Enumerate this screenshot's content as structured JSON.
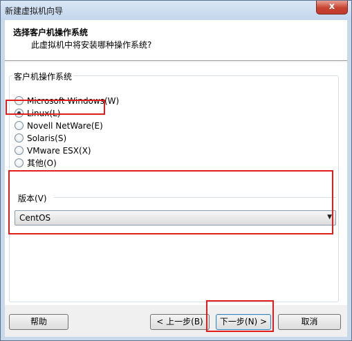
{
  "window": {
    "title": "新建虚拟机向导",
    "close_label": "x"
  },
  "header": {
    "title": "选择客户机操作系统",
    "subtitle": "此虚拟机中将安装哪种操作系统?"
  },
  "os_group": {
    "label": "客户机操作系统",
    "options": [
      {
        "label": "Microsoft Windows(W)",
        "checked": false
      },
      {
        "label": "Linux(L)",
        "checked": true
      },
      {
        "label": "Novell NetWare(E)",
        "checked": false
      },
      {
        "label": "Solaris(S)",
        "checked": false
      },
      {
        "label": "VMware ESX(X)",
        "checked": false
      },
      {
        "label": "其他(O)",
        "checked": false
      }
    ]
  },
  "version": {
    "label": "版本(V)",
    "selected": "CentOS"
  },
  "buttons": {
    "help": "帮助",
    "back": "< 上一步(B)",
    "next": "下一步(N) >",
    "cancel": "取消"
  },
  "colors": {
    "annotation": "#e21b1b",
    "title_gradient_top": "#d9e6f5",
    "close_red": "#c7432f"
  }
}
